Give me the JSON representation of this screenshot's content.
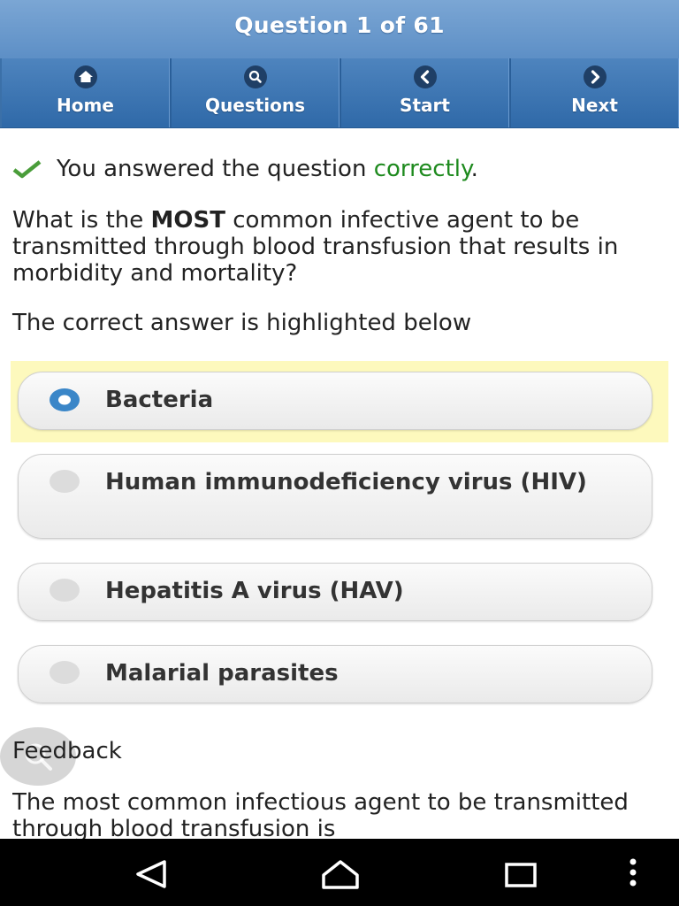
{
  "header": {
    "title": "Question 1 of 61"
  },
  "nav": [
    {
      "label": "Home",
      "icon": "home-icon"
    },
    {
      "label": "Questions",
      "icon": "search-icon"
    },
    {
      "label": "Start",
      "icon": "chevron-left-icon"
    },
    {
      "label": "Next",
      "icon": "chevron-right-icon"
    }
  ],
  "result": {
    "prefix": "You answered the question ",
    "word": "correctly",
    "suffix": ".",
    "accent": "#1e8a1e"
  },
  "question": {
    "before": "What is the ",
    "emphasis": "MOST",
    "after": " common infective agent to be transmitted through blood transfusion that results in morbidity and mortality?"
  },
  "hint": "The correct answer is highlighted below",
  "answers": [
    {
      "label": "Bacteria",
      "selected": true
    },
    {
      "label": "Human immunodeficiency virus (HIV)",
      "selected": false
    },
    {
      "label": "Hepatitis A virus (HAV)",
      "selected": false
    },
    {
      "label": "Malarial parasites",
      "selected": false
    }
  ],
  "feedback": {
    "title": "Feedback",
    "text": "The most common infectious agent to be transmitted through blood transfusion is"
  },
  "system_nav": {
    "back": "back-icon",
    "home": "home-outline-icon",
    "recents": "recents-icon",
    "menu": "more-vert-icon"
  }
}
